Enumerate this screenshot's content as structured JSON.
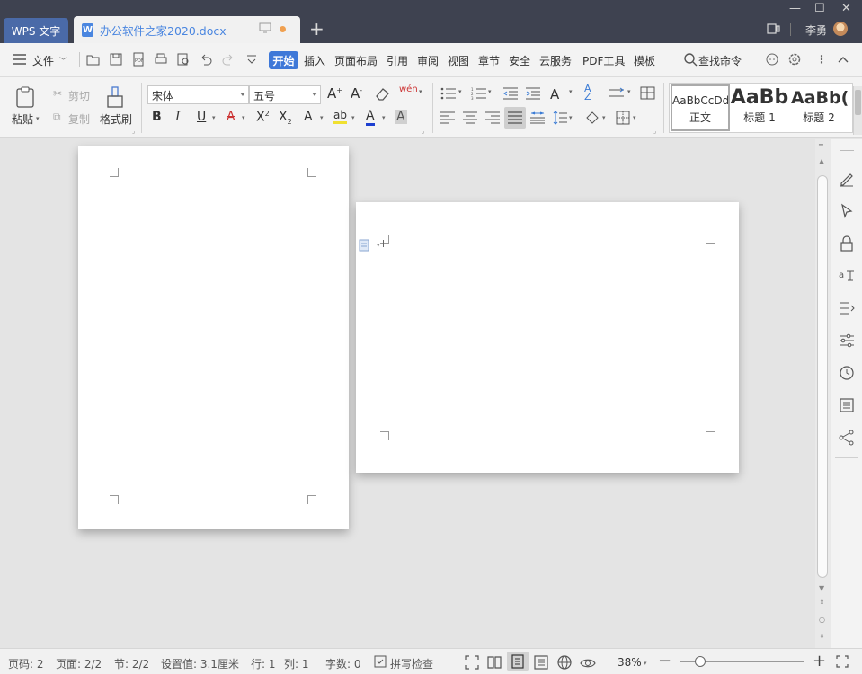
{
  "titlebar": {
    "app_tab": "WPS 文字",
    "doc_tab": "办公软件之家2020.docx",
    "user": "李勇"
  },
  "menubar": {
    "file": "文件",
    "items": [
      "开始",
      "插入",
      "页面布局",
      "引用",
      "审阅",
      "视图",
      "章节",
      "安全",
      "云服务",
      "PDF工具",
      "模板"
    ],
    "search": "查找命令"
  },
  "ribbon": {
    "paste": "粘贴",
    "cut": "剪切",
    "copy": "复制",
    "format_painter": "格式刷",
    "font_name": "宋体",
    "font_size": "五号",
    "styles": [
      {
        "preview": "AaBbCcDd",
        "caption": "正文"
      },
      {
        "preview": "AaBb",
        "caption": "标题 1"
      },
      {
        "preview": "AaBb(",
        "caption": "标题 2"
      }
    ]
  },
  "statusbar": {
    "page_num": "页码: 2",
    "pages": "页面: 2/2",
    "section": "节: 2/2",
    "setting": "设置值: 3.1厘米",
    "row": "行: 1",
    "col": "列: 1",
    "words": "字数: 0",
    "spell": "拼写检查",
    "zoom": "38%"
  },
  "colors": {
    "titlebar": "#3e4250",
    "accent": "#3e78d8",
    "doc_tab_text": "#4a86e0"
  }
}
